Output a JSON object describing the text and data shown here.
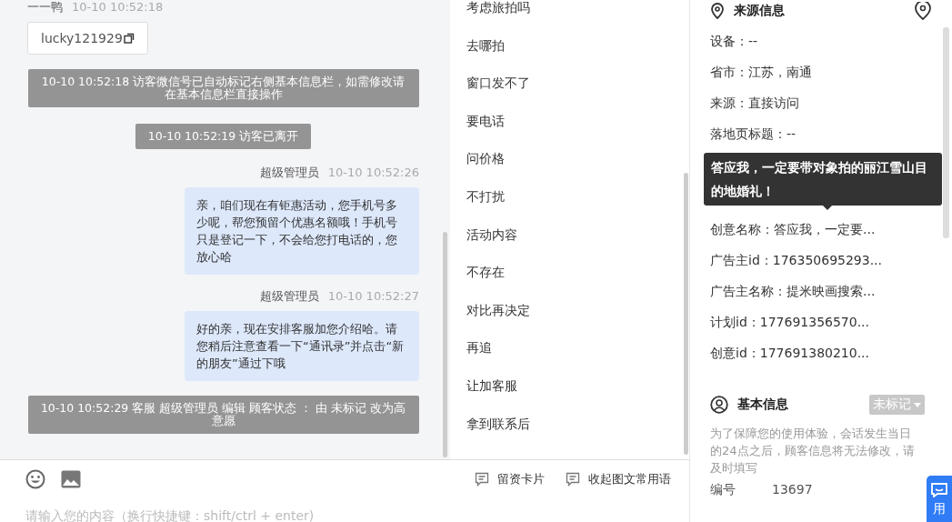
{
  "chat": {
    "messages": [
      {
        "kind": "visitor",
        "sender": "一一鸭",
        "time": "10-10 10:52:18",
        "card": "lucky121929"
      },
      {
        "kind": "system",
        "text": "10-10 10:52:18 访客微信号已自动标记右侧基本信息栏，如需修改请在基本信息栏直接操作"
      },
      {
        "kind": "system",
        "text": "10-10 10:52:19 访客已离开"
      },
      {
        "kind": "agent",
        "sender": "超级管理员",
        "time": "10-10 10:52:26",
        "text": "亲，咱们现在有钜惠活动，您手机号多少呢，帮您预留个优惠名额哦！手机号只是登记一下，不会给您打电话的，您放心哈"
      },
      {
        "kind": "agent",
        "sender": "超级管理员",
        "time": "10-10 10:52:27",
        "text": "好的亲，现在安排客服加您介绍哈。请您稍后注意查看一下“通讯录”并点击“新的朋友”通过下哦"
      },
      {
        "kind": "system",
        "text": "10-10 10:52:29 客服 超级管理员 编辑 顾客状态 ： 由 未标记 改为高意愿"
      }
    ],
    "input": {
      "placeholder": "请输入您的内容（换行快捷键：shift/ctrl + enter)"
    }
  },
  "quick_replies": [
    "考虑旅拍吗",
    "去哪拍",
    "窗口发不了",
    "要电话",
    "问价格",
    "不打扰",
    "活动内容",
    "不存在",
    "对比再决定",
    "再追",
    "让加客服",
    "拿到联系后"
  ],
  "toolbar_buttons": [
    "留资卡片",
    "收起图文常用语"
  ],
  "source_info": {
    "title": "来源信息",
    "fields": [
      {
        "kind": "field",
        "text": "设备：--"
      },
      {
        "kind": "field",
        "text": "省市：江苏，南通"
      },
      {
        "kind": "field",
        "text": "来源：直接访问"
      },
      {
        "kind": "field",
        "text": "落地页标题：--"
      },
      {
        "kind": "tooltip",
        "text": "答应我，一定要带对象拍的丽江雪山目的地婚礼！"
      },
      {
        "kind": "field",
        "text": "创意名称：答应我，一定要..."
      },
      {
        "kind": "field",
        "text": "广告主id：176350695293..."
      },
      {
        "kind": "field",
        "text": "广告主名称：提米映画搜索..."
      },
      {
        "kind": "field",
        "text": "计划id：177691356570..."
      },
      {
        "kind": "field",
        "text": "创意id：177691380210..."
      }
    ]
  },
  "basic_info": {
    "title": "基本信息",
    "status": "未标记",
    "note": "为了保障您的使用体验，会话发生当日的24点之后，顾客信息将无法修改，请及时填写",
    "fields": [
      {
        "label": "编号",
        "value": "13697"
      }
    ]
  },
  "float_button": "用"
}
